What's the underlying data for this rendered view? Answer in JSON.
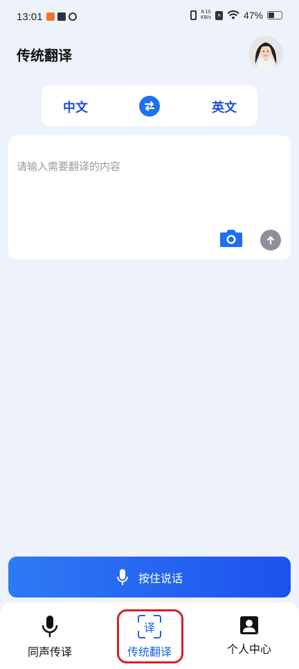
{
  "status_bar": {
    "time": "13:01",
    "net_speed_value": "8.10",
    "net_speed_unit": "KB/s",
    "battery_percent": "47%",
    "battery_level": 0.47
  },
  "header": {
    "title": "传统翻译"
  },
  "language": {
    "source": "中文",
    "target": "英文"
  },
  "input": {
    "placeholder": "请输入需要翻译的内容",
    "value": ""
  },
  "talk_button": {
    "label": "按住说话"
  },
  "bottom_nav": {
    "items": [
      {
        "label": "同声传译",
        "icon": "microphone-icon",
        "active": false
      },
      {
        "label": "传统翻译",
        "icon": "translate-scan-icon",
        "glyph": "译",
        "active": true
      },
      {
        "label": "个人中心",
        "icon": "profile-icon",
        "active": false
      }
    ]
  },
  "colors": {
    "accent": "#1e6ff5",
    "background": "#eef2fa",
    "highlight": "#d81e2a"
  }
}
